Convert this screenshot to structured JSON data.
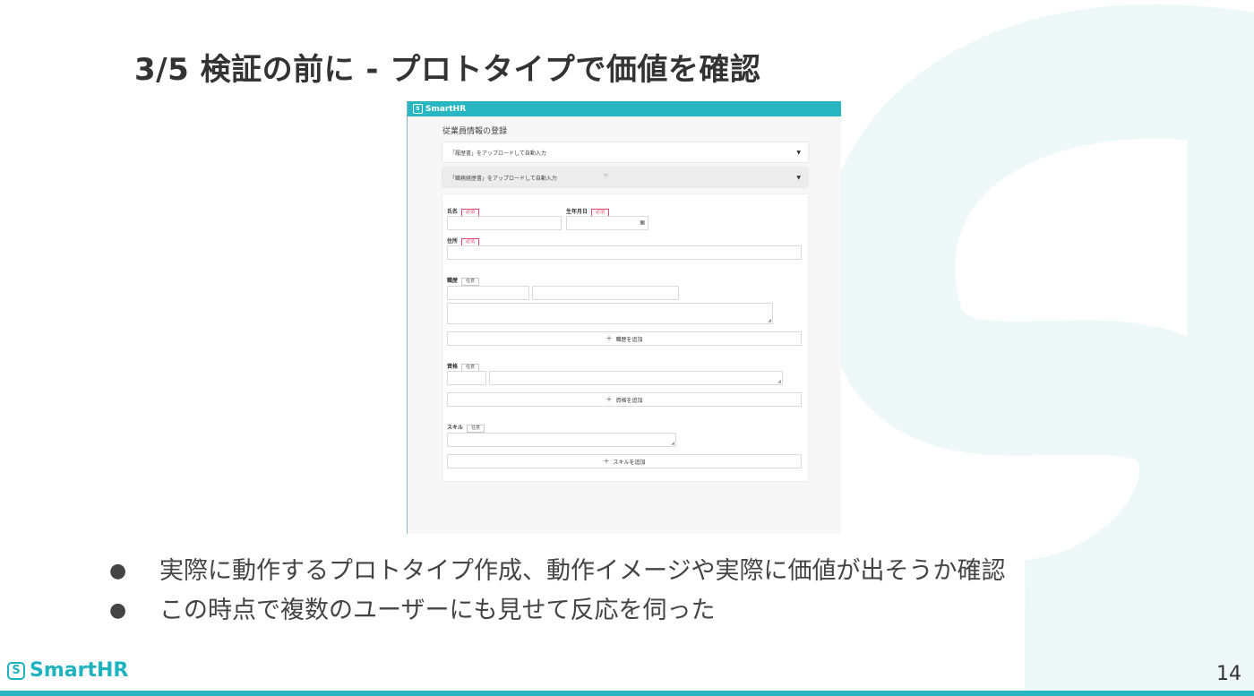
{
  "slide": {
    "title": "3/5 検証の前に - プロトタイプで価値を確認",
    "page_number": "14",
    "footer_logo_text": "SmartHR",
    "brand_color": "#28b7c2"
  },
  "screenshot": {
    "brand": "SmartHR",
    "page_heading": "従業員情報の登録",
    "accordions": [
      {
        "label": "「履歴書」をアップロードして自動入力"
      },
      {
        "label": "「職務経歴書」をアップロードして自動入力"
      }
    ],
    "fields": {
      "name_label": "氏名",
      "birth_label": "生年月日",
      "address_label": "住所",
      "history_label": "職歴",
      "qualification_label": "資格",
      "skill_label": "スキル",
      "required_badge": "必須",
      "optional_badge": "任意"
    },
    "buttons": {
      "add_history": "職歴を追加",
      "add_qualification": "資格を追加",
      "add_skill": "スキルを追加"
    }
  },
  "bullets": [
    "実際に動作するプロトタイプ作成、動作イメージや実際に価値が出そうか確認",
    "この時点で複数のユーザーにも見せて反応を伺った"
  ]
}
